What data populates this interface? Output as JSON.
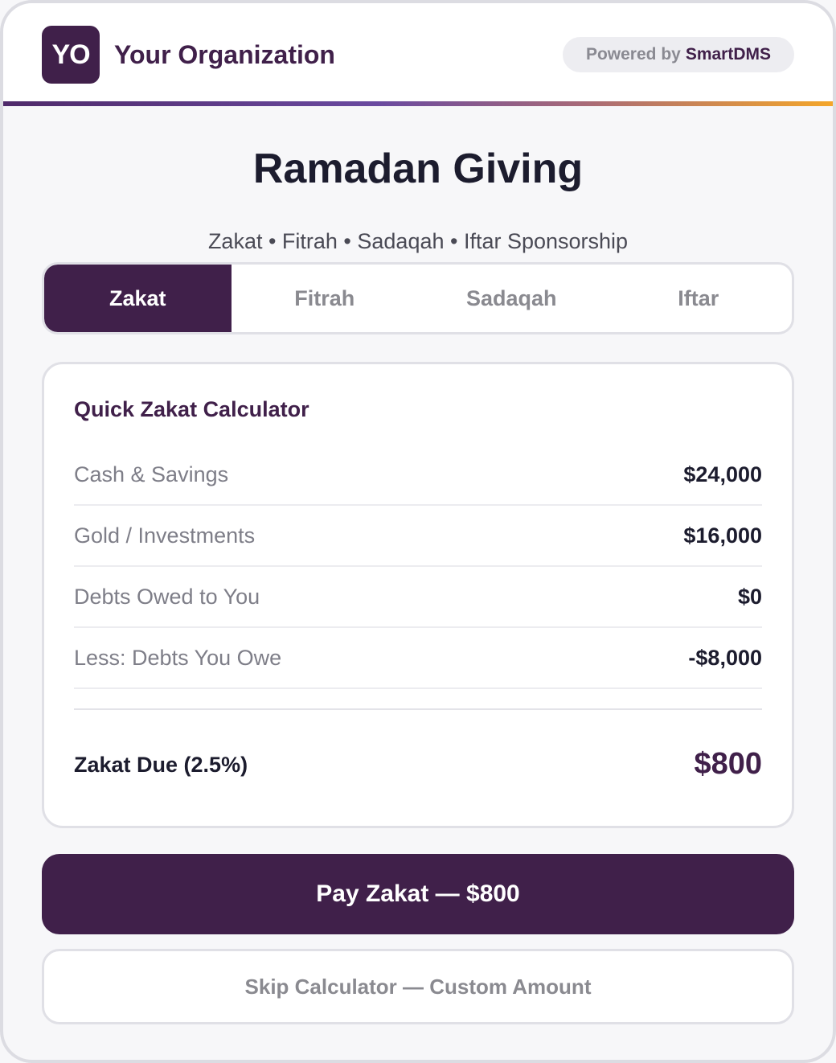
{
  "header": {
    "logo_initials": "YO",
    "org_name": "Your Organization",
    "powered_prefix": "Powered by",
    "powered_brand": "SmartDMS"
  },
  "page": {
    "title": "Ramadan Giving",
    "subtitle": "Zakat • Fitrah • Sadaqah • Iftar Sponsorship"
  },
  "tabs": [
    {
      "label": "Zakat",
      "active": true
    },
    {
      "label": "Fitrah",
      "active": false
    },
    {
      "label": "Sadaqah",
      "active": false
    },
    {
      "label": "Iftar",
      "active": false
    }
  ],
  "calculator": {
    "title": "Quick Zakat Calculator",
    "rows": [
      {
        "label": "Cash & Savings",
        "value": "$24,000"
      },
      {
        "label": "Gold / Investments",
        "value": "$16,000"
      },
      {
        "label": "Debts Owed to You",
        "value": "$0"
      },
      {
        "label": "Less: Debts You Owe",
        "value": "-$8,000"
      }
    ],
    "total_label": "Zakat Due (2.5%)",
    "total_value": "$800"
  },
  "actions": {
    "pay_label": "Pay Zakat — $800",
    "skip_label": "Skip Calculator — Custom Amount"
  },
  "colors": {
    "brand": "#40204a",
    "accent_gradient_start": "#4f2a6a",
    "accent_gradient_end": "#f4a62a"
  }
}
